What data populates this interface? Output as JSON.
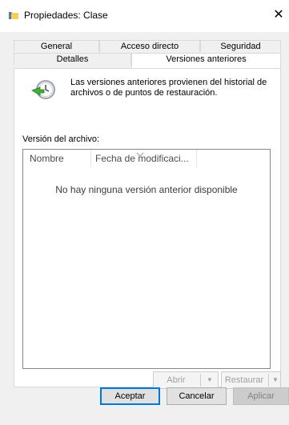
{
  "window": {
    "title": "Propiedades: Clase",
    "close_glyph": "✕",
    "title_icon": "folder-icon"
  },
  "tabs": {
    "row1": [
      "General",
      "Acceso directo",
      "Seguridad"
    ],
    "row2": [
      "Detalles",
      "Versiones anteriores"
    ],
    "active": "Versiones anteriores"
  },
  "info": {
    "text": "Las versiones anteriores provienen del historial de archivos o de puntos de restauración.",
    "icon": "restore-clock-icon"
  },
  "versions": {
    "label": "Versión del archivo:",
    "columns": [
      "Nombre",
      "Fecha de modificaci..."
    ],
    "empty_message": "No hay ninguna versión anterior disponible",
    "sort_icon": "sort-caret-icon"
  },
  "actions": {
    "open_label": "Abrir",
    "restore_label": "Restaurar",
    "dropdown_glyph": "▼"
  },
  "footer": {
    "ok_label": "Aceptar",
    "cancel_label": "Cancelar",
    "apply_label": "Aplicar"
  },
  "colors": {
    "accent": "#0078d7",
    "client_bg": "#f0f0f0",
    "list_border": "#828790"
  }
}
